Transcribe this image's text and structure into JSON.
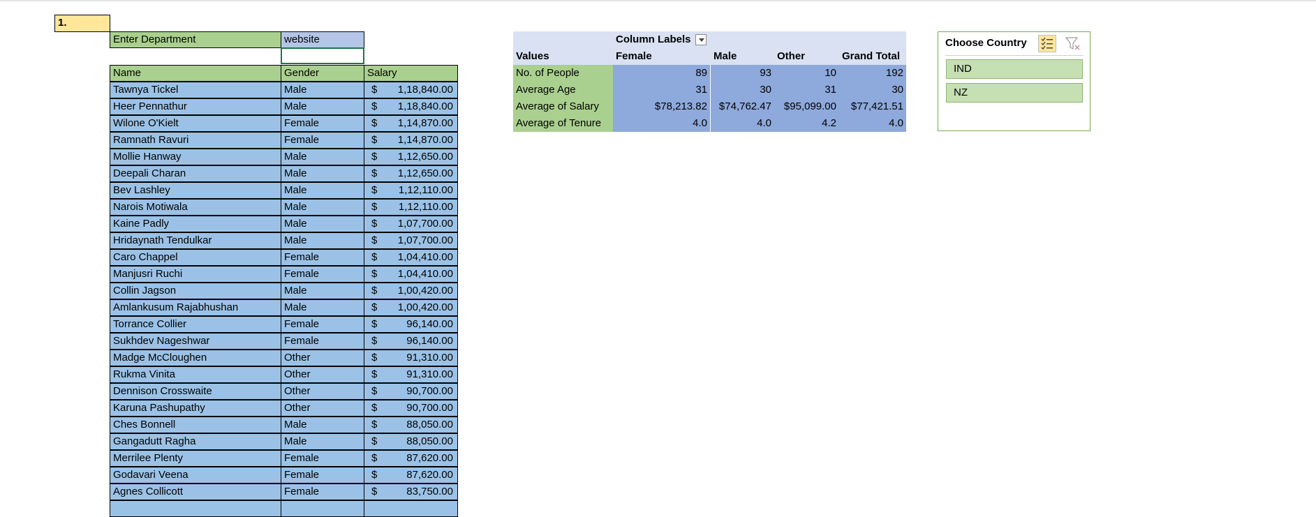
{
  "marker": "1.",
  "department": {
    "label": "Enter Department",
    "value": "website",
    "input_value": ""
  },
  "table": {
    "headers": [
      "Name",
      "Gender",
      "Salary"
    ],
    "currency_symbol": "$",
    "rows": [
      [
        "Tawnya Tickel",
        "Male",
        "1,18,840.00"
      ],
      [
        "Heer Pennathur",
        "Male",
        "1,18,840.00"
      ],
      [
        "Wilone O'Kielt",
        "Female",
        "1,14,870.00"
      ],
      [
        "Ramnath Ravuri",
        "Female",
        "1,14,870.00"
      ],
      [
        "Mollie Hanway",
        "Male",
        "1,12,650.00"
      ],
      [
        "Deepali Charan",
        "Male",
        "1,12,650.00"
      ],
      [
        "Bev Lashley",
        "Male",
        "1,12,110.00"
      ],
      [
        "Narois Motiwala",
        "Male",
        "1,12,110.00"
      ],
      [
        "Kaine Padly",
        "Male",
        "1,07,700.00"
      ],
      [
        "Hridaynath Tendulkar",
        "Male",
        "1,07,700.00"
      ],
      [
        "Caro Chappel",
        "Female",
        "1,04,410.00"
      ],
      [
        "Manjusri Ruchi",
        "Female",
        "1,04,410.00"
      ],
      [
        "Collin Jagson",
        "Male",
        "1,00,420.00"
      ],
      [
        "Amlankusum Rajabhushan",
        "Male",
        "1,00,420.00"
      ],
      [
        "Torrance Collier",
        "Female",
        "96,140.00"
      ],
      [
        "Sukhdev Nageshwar",
        "Female",
        "96,140.00"
      ],
      [
        "Madge McCloughen",
        "Other",
        "91,310.00"
      ],
      [
        "Rukma Vinita",
        "Other",
        "91,310.00"
      ],
      [
        "Dennison Crosswaite",
        "Other",
        "90,700.00"
      ],
      [
        "Karuna Pashupathy",
        "Other",
        "90,700.00"
      ],
      [
        "Ches Bonnell",
        "Male",
        "88,050.00"
      ],
      [
        "Gangadutt Ragha",
        "Male",
        "88,050.00"
      ],
      [
        "Merrilee Plenty",
        "Female",
        "87,620.00"
      ],
      [
        "Godavari Veena",
        "Female",
        "87,620.00"
      ],
      [
        "Agnes Collicott",
        "Female",
        "83,750.00"
      ]
    ]
  },
  "pivot": {
    "column_labels": "Column Labels",
    "values_header": "Values",
    "columns": [
      "Female",
      "Male",
      "Other",
      "Grand Total"
    ],
    "rows": [
      {
        "label": "No. of People",
        "values": [
          "89",
          "93",
          "10",
          "192"
        ]
      },
      {
        "label": "Average Age",
        "values": [
          "31",
          "30",
          "31",
          "30"
        ]
      },
      {
        "label": "Average of Salary",
        "values": [
          "$78,213.82",
          "$74,762.47",
          "$95,099.00",
          "$77,421.51"
        ]
      },
      {
        "label": "Average of Tenure",
        "values": [
          "4.0",
          "4.0",
          "4.2",
          "4.0"
        ]
      }
    ]
  },
  "slicer": {
    "title": "Choose Country",
    "items": [
      "IND",
      "NZ"
    ]
  },
  "colors": {
    "header_green": "#a9d08e",
    "row_blue": "#9bc2e6",
    "pivot_value_blue": "#8ea9db",
    "marker_yellow": "#ffe699",
    "slicer_item_green": "#c6e0b4"
  }
}
